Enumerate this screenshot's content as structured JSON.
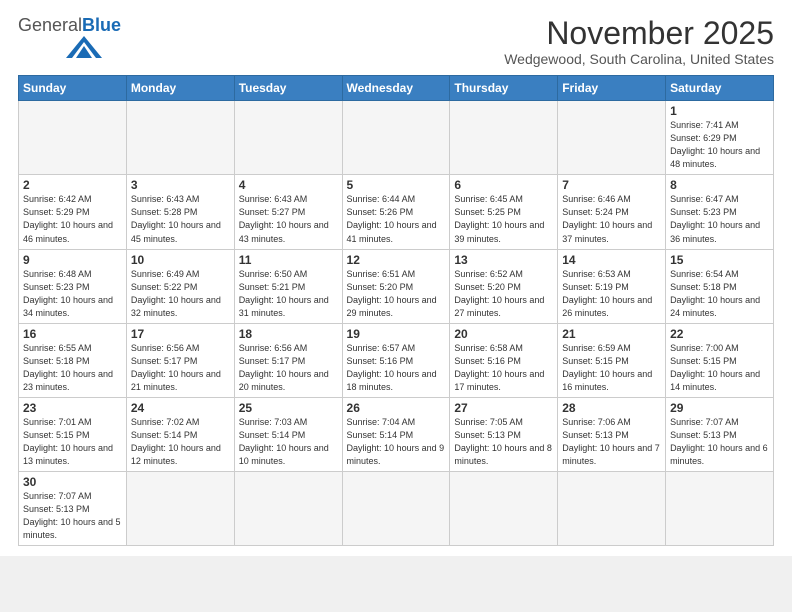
{
  "header": {
    "logo_general": "General",
    "logo_blue": "Blue",
    "month_title": "November 2025",
    "location": "Wedgewood, South Carolina, United States"
  },
  "weekdays": [
    "Sunday",
    "Monday",
    "Tuesday",
    "Wednesday",
    "Thursday",
    "Friday",
    "Saturday"
  ],
  "weeks": [
    [
      {
        "day": "",
        "info": ""
      },
      {
        "day": "",
        "info": ""
      },
      {
        "day": "",
        "info": ""
      },
      {
        "day": "",
        "info": ""
      },
      {
        "day": "",
        "info": ""
      },
      {
        "day": "",
        "info": ""
      },
      {
        "day": "1",
        "info": "Sunrise: 7:41 AM\nSunset: 6:29 PM\nDaylight: 10 hours\nand 48 minutes."
      }
    ],
    [
      {
        "day": "2",
        "info": "Sunrise: 6:42 AM\nSunset: 5:29 PM\nDaylight: 10 hours\nand 46 minutes."
      },
      {
        "day": "3",
        "info": "Sunrise: 6:43 AM\nSunset: 5:28 PM\nDaylight: 10 hours\nand 45 minutes."
      },
      {
        "day": "4",
        "info": "Sunrise: 6:43 AM\nSunset: 5:27 PM\nDaylight: 10 hours\nand 43 minutes."
      },
      {
        "day": "5",
        "info": "Sunrise: 6:44 AM\nSunset: 5:26 PM\nDaylight: 10 hours\nand 41 minutes."
      },
      {
        "day": "6",
        "info": "Sunrise: 6:45 AM\nSunset: 5:25 PM\nDaylight: 10 hours\nand 39 minutes."
      },
      {
        "day": "7",
        "info": "Sunrise: 6:46 AM\nSunset: 5:24 PM\nDaylight: 10 hours\nand 37 minutes."
      },
      {
        "day": "8",
        "info": "Sunrise: 6:47 AM\nSunset: 5:23 PM\nDaylight: 10 hours\nand 36 minutes."
      }
    ],
    [
      {
        "day": "9",
        "info": "Sunrise: 6:48 AM\nSunset: 5:23 PM\nDaylight: 10 hours\nand 34 minutes."
      },
      {
        "day": "10",
        "info": "Sunrise: 6:49 AM\nSunset: 5:22 PM\nDaylight: 10 hours\nand 32 minutes."
      },
      {
        "day": "11",
        "info": "Sunrise: 6:50 AM\nSunset: 5:21 PM\nDaylight: 10 hours\nand 31 minutes."
      },
      {
        "day": "12",
        "info": "Sunrise: 6:51 AM\nSunset: 5:20 PM\nDaylight: 10 hours\nand 29 minutes."
      },
      {
        "day": "13",
        "info": "Sunrise: 6:52 AM\nSunset: 5:20 PM\nDaylight: 10 hours\nand 27 minutes."
      },
      {
        "day": "14",
        "info": "Sunrise: 6:53 AM\nSunset: 5:19 PM\nDaylight: 10 hours\nand 26 minutes."
      },
      {
        "day": "15",
        "info": "Sunrise: 6:54 AM\nSunset: 5:18 PM\nDaylight: 10 hours\nand 24 minutes."
      }
    ],
    [
      {
        "day": "16",
        "info": "Sunrise: 6:55 AM\nSunset: 5:18 PM\nDaylight: 10 hours\nand 23 minutes."
      },
      {
        "day": "17",
        "info": "Sunrise: 6:56 AM\nSunset: 5:17 PM\nDaylight: 10 hours\nand 21 minutes."
      },
      {
        "day": "18",
        "info": "Sunrise: 6:56 AM\nSunset: 5:17 PM\nDaylight: 10 hours\nand 20 minutes."
      },
      {
        "day": "19",
        "info": "Sunrise: 6:57 AM\nSunset: 5:16 PM\nDaylight: 10 hours\nand 18 minutes."
      },
      {
        "day": "20",
        "info": "Sunrise: 6:58 AM\nSunset: 5:16 PM\nDaylight: 10 hours\nand 17 minutes."
      },
      {
        "day": "21",
        "info": "Sunrise: 6:59 AM\nSunset: 5:15 PM\nDaylight: 10 hours\nand 16 minutes."
      },
      {
        "day": "22",
        "info": "Sunrise: 7:00 AM\nSunset: 5:15 PM\nDaylight: 10 hours\nand 14 minutes."
      }
    ],
    [
      {
        "day": "23",
        "info": "Sunrise: 7:01 AM\nSunset: 5:15 PM\nDaylight: 10 hours\nand 13 minutes."
      },
      {
        "day": "24",
        "info": "Sunrise: 7:02 AM\nSunset: 5:14 PM\nDaylight: 10 hours\nand 12 minutes."
      },
      {
        "day": "25",
        "info": "Sunrise: 7:03 AM\nSunset: 5:14 PM\nDaylight: 10 hours\nand 10 minutes."
      },
      {
        "day": "26",
        "info": "Sunrise: 7:04 AM\nSunset: 5:14 PM\nDaylight: 10 hours\nand 9 minutes."
      },
      {
        "day": "27",
        "info": "Sunrise: 7:05 AM\nSunset: 5:13 PM\nDaylight: 10 hours\nand 8 minutes."
      },
      {
        "day": "28",
        "info": "Sunrise: 7:06 AM\nSunset: 5:13 PM\nDaylight: 10 hours\nand 7 minutes."
      },
      {
        "day": "29",
        "info": "Sunrise: 7:07 AM\nSunset: 5:13 PM\nDaylight: 10 hours\nand 6 minutes."
      }
    ],
    [
      {
        "day": "30",
        "info": "Sunrise: 7:07 AM\nSunset: 5:13 PM\nDaylight: 10 hours\nand 5 minutes."
      },
      {
        "day": "",
        "info": ""
      },
      {
        "day": "",
        "info": ""
      },
      {
        "day": "",
        "info": ""
      },
      {
        "day": "",
        "info": ""
      },
      {
        "day": "",
        "info": ""
      },
      {
        "day": "",
        "info": ""
      }
    ]
  ]
}
